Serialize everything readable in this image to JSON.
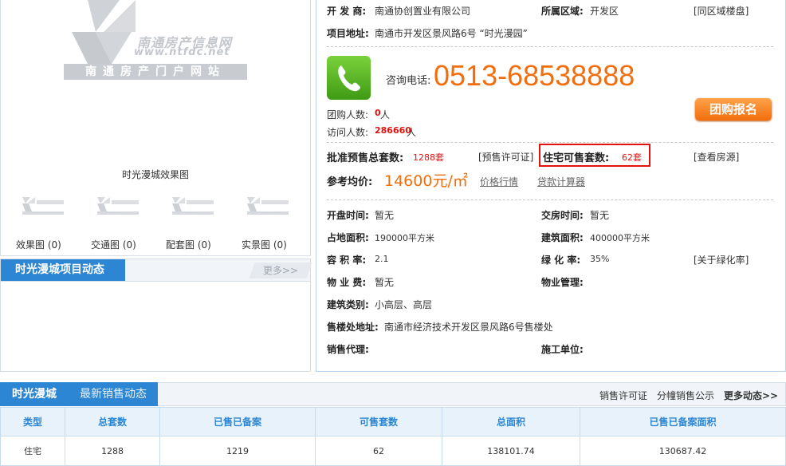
{
  "left": {
    "logo": {
      "line1": "南通房产信息网",
      "line2": "www.ntfdc.net",
      "line3": "南通房产门户网站"
    },
    "caption": "时光漫城效果图",
    "tabs": [
      {
        "label": "效果图 (0)"
      },
      {
        "label": "交通图 (0)"
      },
      {
        "label": "配套图 (0)"
      },
      {
        "label": "实景图 (0)"
      }
    ],
    "dynamics": {
      "title": "时光漫城项目动态",
      "more": "更多>>"
    }
  },
  "info": {
    "developer_label": "开 发 商:",
    "developer": "南通协创置业有限公司",
    "region_label": "所属区域:",
    "region": "开发区",
    "region_link": "[同区域楼盘]",
    "address_label": "项目地址:",
    "address": "南通市开发区景风路6号 “时光漫园”",
    "phone_label": "咨询电话:",
    "phone": "0513-68538888",
    "group_label": "团购人数:",
    "group_count": "0",
    "group_unit": "人",
    "visit_label": "访问人数:",
    "visit_count": "286660",
    "visit_unit": "人",
    "group_button": "团购报名",
    "presale_label": "批准预售总套数:",
    "presale": "1288套",
    "presale_link": "[预售许可证]",
    "avail_label": "住宅可售套数:",
    "avail": "62套",
    "avail_link": "[查看房源]",
    "price_label": "参考均价:",
    "price": "14600元/㎡",
    "price_link1": "价格行情",
    "price_link2": "贷款计算器",
    "open_label": "开盘时间:",
    "open": "暂无",
    "deliver_label": "交房时间:",
    "deliver": "暂无",
    "land_label": "占地面积:",
    "land": "190000平方米",
    "build_label": "建筑面积:",
    "build": "400000平方米",
    "far_label": "容 积 率:",
    "far": "2.1",
    "green_label": "绿 化 率:",
    "green": "35%",
    "green_link": "[关于绿化率]",
    "fee_label": "物 业 费:",
    "fee": "暂无",
    "mgmt_label": "物业管理:",
    "type_label": "建筑类别:",
    "type": "小高层、高层",
    "sales_addr_label": "售楼处地址:",
    "sales_addr": "南通市经济技术开发区景风路6号售楼处",
    "agent_label": "销售代理:",
    "constructor_label": "施工单位:"
  },
  "table": {
    "tab1": "时光漫城",
    "tab2": "最新销售动态",
    "links": [
      "销售许可证",
      "分幢销售公示",
      "更多动态>>"
    ],
    "headers": [
      "类型",
      "总套数",
      "已售已备案",
      "可售套数",
      "总面积",
      "已售已备案面积"
    ],
    "rows": [
      [
        "住宅",
        "1288",
        "1219",
        "62",
        "138101.74",
        "130687.42"
      ]
    ]
  }
}
